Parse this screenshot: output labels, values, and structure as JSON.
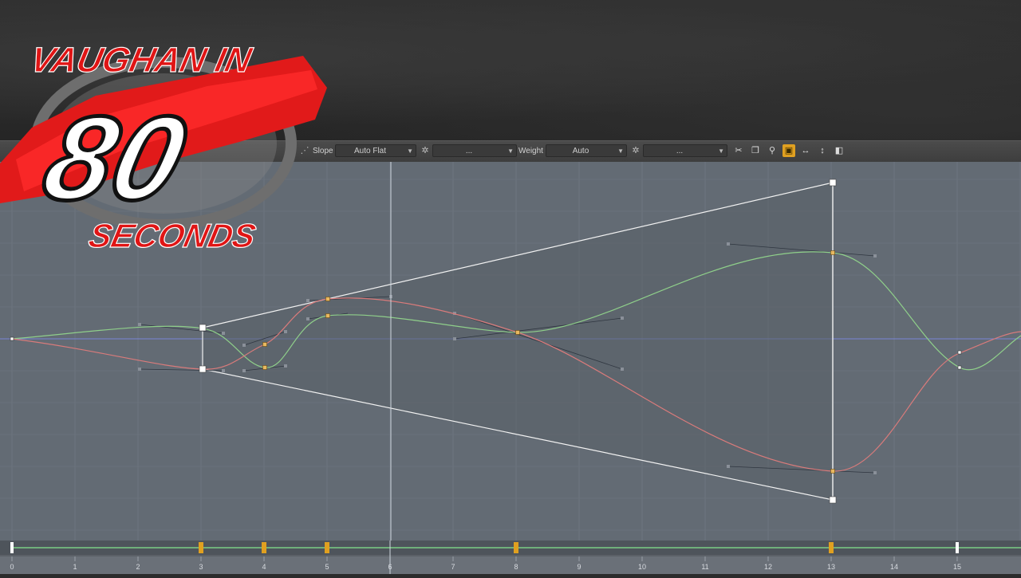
{
  "logo": {
    "line1": "VAUGHAN IN",
    "number": "80",
    "line2": "SECONDS"
  },
  "toolbar": {
    "slope_label": "Slope",
    "slope_value": "Auto Flat",
    "slope_extra": "...",
    "weight_label": "Weight",
    "weight_value": "Auto",
    "weight_extra": "...",
    "tools": [
      {
        "icon": "scissors-icon",
        "glyph": "✂",
        "active": false
      },
      {
        "icon": "copy-icon",
        "glyph": "❐",
        "active": false
      },
      {
        "icon": "pin-icon",
        "glyph": "⚲",
        "active": false
      },
      {
        "icon": "frame-all-icon",
        "glyph": "▣",
        "active": true
      },
      {
        "icon": "fit-horizontal-icon",
        "glyph": "↔",
        "active": false
      },
      {
        "icon": "fit-vertical-icon",
        "glyph": "↕",
        "active": false
      },
      {
        "icon": "value-icon",
        "glyph": "◧",
        "active": false
      }
    ]
  },
  "timeline": {
    "frames": [
      "0",
      "1",
      "2",
      "3",
      "4",
      "5",
      "6",
      "7",
      "8",
      "9",
      "10",
      "11",
      "12",
      "13",
      "14",
      "15"
    ],
    "current_frame": 6,
    "keyframes": [
      3,
      4,
      5,
      8,
      13
    ],
    "selected_keys": [
      0,
      15
    ]
  },
  "colors": {
    "accent": "#e0a020",
    "green_curve": "#8fcf8a",
    "red_curve": "#d97b7b",
    "zero_line": "#7a86d6"
  }
}
